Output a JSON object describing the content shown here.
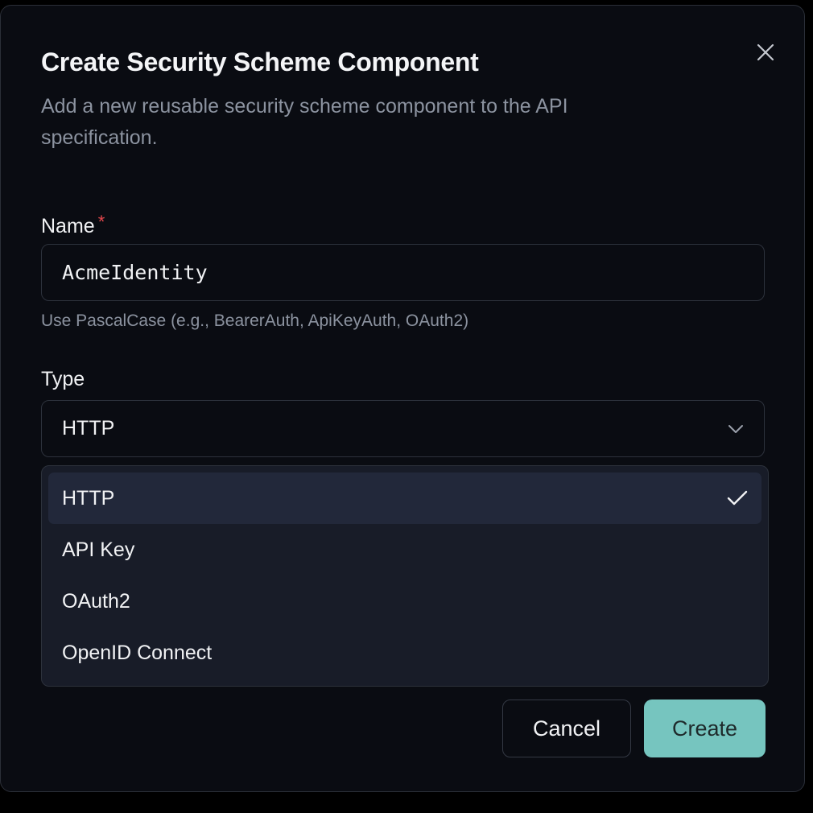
{
  "dialog": {
    "title": "Create Security Scheme Component",
    "description": "Add a new reusable security scheme component to the API specification.",
    "close_icon": "close-icon"
  },
  "name_field": {
    "label": "Name",
    "required_marker": "*",
    "value": "AcmeIdentity",
    "hint": "Use PascalCase (e.g., BearerAuth, ApiKeyAuth, OAuth2)"
  },
  "type_field": {
    "label": "Type",
    "selected": "HTTP",
    "chevron_icon": "chevron-down-icon",
    "options": [
      {
        "label": "HTTP",
        "selected": true
      },
      {
        "label": "API Key",
        "selected": false
      },
      {
        "label": "OAuth2",
        "selected": false
      },
      {
        "label": "OpenID Connect",
        "selected": false
      }
    ],
    "check_icon": "check-icon"
  },
  "actions": {
    "cancel_label": "Cancel",
    "create_label": "Create"
  },
  "colors": {
    "background": "#0a0c12",
    "accent": "#76c5bf",
    "required": "#e5484d",
    "dropdown_bg": "#181c28",
    "selected_option_bg": "#22283a"
  }
}
